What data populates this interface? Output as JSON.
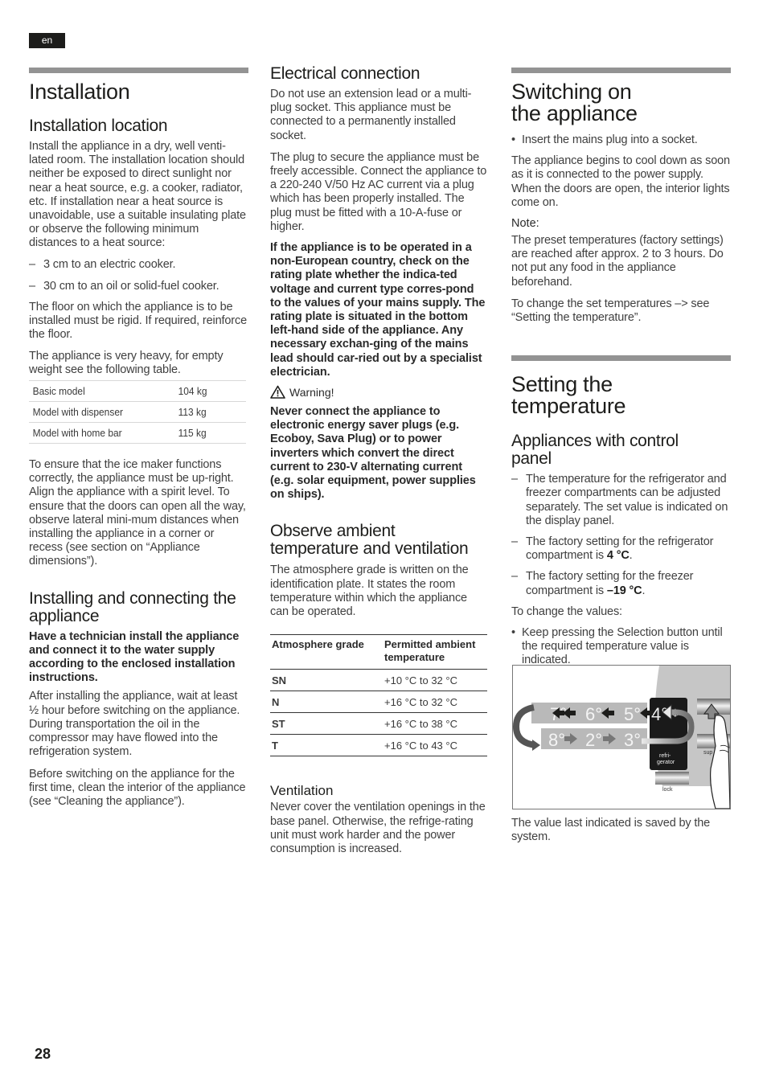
{
  "language": "en",
  "page_number": "28",
  "installation": {
    "title": "Installation",
    "location": {
      "heading": "Installation location",
      "intro": "Install the appliance in a dry, well venti-lated room. The installation location should neither be exposed to direct sunlight nor near a heat source, e.g. a cooker, radiator, etc. If installation near a heat source is unavoidable, use a suitable insulating plate or observe the following minimum distances to a heat source:",
      "distances": [
        "3 cm to an electric cooker.",
        "30 cm to an oil or solid-fuel cooker."
      ],
      "floor": "The floor on which the appliance is to be installed must be rigid. If required, reinforce the floor.",
      "weight_intro": "The appliance is very heavy, for empty weight see the following table.",
      "weights": [
        {
          "model": "Basic model",
          "weight": "104 kg"
        },
        {
          "model": "Model with dispenser",
          "weight": "113 kg"
        },
        {
          "model": "Model with home bar",
          "weight": "115 kg"
        }
      ],
      "ice_maker": "To ensure that the ice maker functions correctly, the appliance must be up-right. Align the appliance with a spirit level. To ensure that the doors can open all the way, observe lateral mini-mum distances when installing the appliance in a corner or recess (see section on “Appliance dimensions”)."
    },
    "connecting": {
      "heading": "Installing and connecting the appliance",
      "bold": "Have a technician install the appliance and connect it to the water supply according to the enclosed installation instructions.",
      "wait": "After installing the appliance, wait at least ½ hour before switching on the appliance. During transportation the oil in the compressor may have flowed into the refrigeration system.",
      "clean": "Before switching on the appliance for the first time, clean the interior of the appliance (see “Cleaning the appliance”)."
    }
  },
  "electrical": {
    "heading": "Electrical connection",
    "p1": "Do not use an extension lead or a multi-plug socket. This appliance must be connected to a permanently installed socket.",
    "p2": "The plug to secure the appliance must be freely accessible. Connect the appliance to a 220-240 V/50 Hz AC current via a plug which has been properly installed. The plug must be fitted with a 10-A-fuse or higher.",
    "bold": "If the appliance is to be operated in a non-European country, check on the rating plate whether the indica-ted voltage and current type corres-pond to the values of your mains supply. The rating plate is situated in the bottom left-hand side of the appliance. Any necessary exchan-ging of the mains lead should car-ried out by a specialist electrician.",
    "warning_label": "Warning!",
    "warning_text": "Never connect the appliance to electronic energy saver plugs (e.g. Ecoboy, Sava Plug) or to power inverters which convert the direct current to 230-V alternating current (e.g. solar equipment, power supplies on ships)."
  },
  "ambient": {
    "heading": "Observe ambient temperature and ventilation",
    "intro": "The atmosphere grade is written on the identification plate. It states the room temperature within which the appliance can be operated.",
    "table_headers": [
      "Atmosphere grade",
      "Permitted ambient temperature"
    ],
    "grades": [
      {
        "grade": "SN",
        "range": "+10 °C to 32 °C"
      },
      {
        "grade": "N",
        "range": "+16 °C to 32 °C"
      },
      {
        "grade": "ST",
        "range": "+16 °C to 38 °C"
      },
      {
        "grade": "T",
        "range": "+16 °C to 43 °C"
      }
    ],
    "ventilation_heading": "Ventilation",
    "ventilation_text": "Never cover the ventilation openings in the base panel. Otherwise, the refrige-rating unit must work harder and the power consumption is increased."
  },
  "switching_on": {
    "title": "Switching on the appliance",
    "bullet": "Insert the mains plug into a socket.",
    "p1": "The appliance begins to cool down as soon as it is connected to the power supply. When the doors are open, the interior lights come on.",
    "note_label": "Note:",
    "note": "The preset temperatures (factory settings) are reached after approx. 2 to 3 hours. Do not put any food in the appliance beforehand.",
    "see": "To change the set temperatures –> see “Setting the temperature”."
  },
  "setting_temp": {
    "title": "Setting the temperature",
    "subheading": "Appliances with control panel",
    "items": [
      {
        "text": "The temperature for the refrigerator and freezer compartments can be adjusted separately. The set value is indicated on the display panel.",
        "value": ""
      },
      {
        "text": "The factory setting for the refrigerator compartment is ",
        "value": "4 °C"
      },
      {
        "text": "The factory setting for the freezer compartment is ",
        "value": "–19 °C"
      }
    ],
    "change_label": "To change the values:",
    "bullet": "Keep pressing the Selection button until the required temperature value is indicated.",
    "figure": {
      "top_row": [
        "7°",
        "6°",
        "5°"
      ],
      "bottom_row": [
        "8°",
        "2°",
        "3°"
      ],
      "current": "4°",
      "display_label": "refri-\ngerator",
      "button_labels": [
        "sup",
        "lock"
      ]
    },
    "saved": "The value last indicated is saved by the system."
  }
}
